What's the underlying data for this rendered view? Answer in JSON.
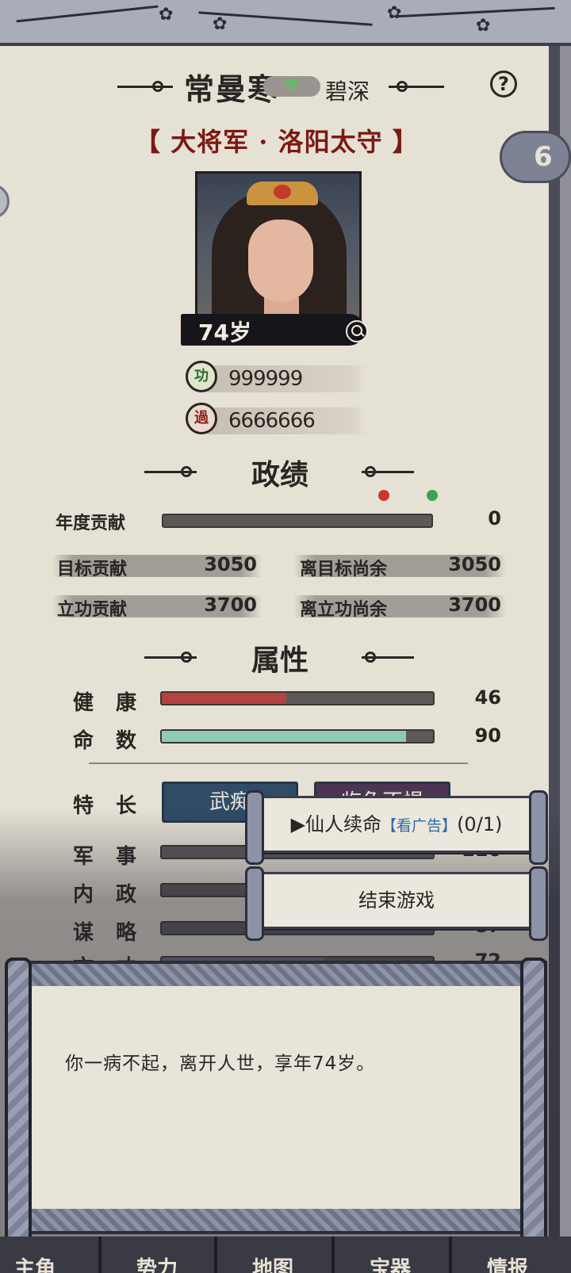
{
  "character": {
    "surname": "常曼寒",
    "zi_label": "字",
    "zi_name": "碧深",
    "title_line": "【 大将军 · 洛阳太守 】",
    "age_label": "74岁",
    "cloud_count": "6"
  },
  "merit": {
    "icon_label": "功",
    "marks": "999999"
  },
  "demerit": {
    "icon_label": "過",
    "marks": "6666666"
  },
  "achievement": {
    "header": "政绩",
    "annual_label": "年度贡献",
    "annual_value": "0",
    "annual_fraction": 0,
    "target_label": "目标贡献",
    "target_value": "3050",
    "remain_target_label": "离目标尚余",
    "remain_target_value": "3050",
    "merit_label": "立功贡献",
    "merit_value": "3700",
    "remain_merit_label": "离立功尚余",
    "remain_merit_value": "3700"
  },
  "attributes": {
    "header": "属性",
    "health_label": "健康",
    "health_value": "46",
    "health_fraction": 0.46,
    "fate_label": "命数",
    "fate_value": "90",
    "fate_fraction": 0.9,
    "specialty_label": "特长",
    "specialty_1": "武痴",
    "specialty_2": "临危不惧",
    "military_label": "军事",
    "military_value": "116",
    "admin_label": "内政",
    "strategy_label": "谋略",
    "strategy_value": "87",
    "literary_label": "文才",
    "literary_value": "72",
    "literary_fraction": 0.6
  },
  "popup": {
    "revive_label": "▶仙人续命",
    "revive_ad": "【看广告】",
    "revive_count": "(0/1)",
    "end_game_label": "结束游戏"
  },
  "message": {
    "text": "你一病不起，离开人世，享年74岁。"
  },
  "nav": {
    "items": [
      "主角",
      "势力",
      "地图",
      "宝器",
      "情报"
    ]
  },
  "colors": {
    "health_fill": "#b24341",
    "fate_fill": "#8fcbb4",
    "title_red": "#7a1a12",
    "trait_blue": "#2f4b66",
    "trait_purple": "#4a3552"
  }
}
